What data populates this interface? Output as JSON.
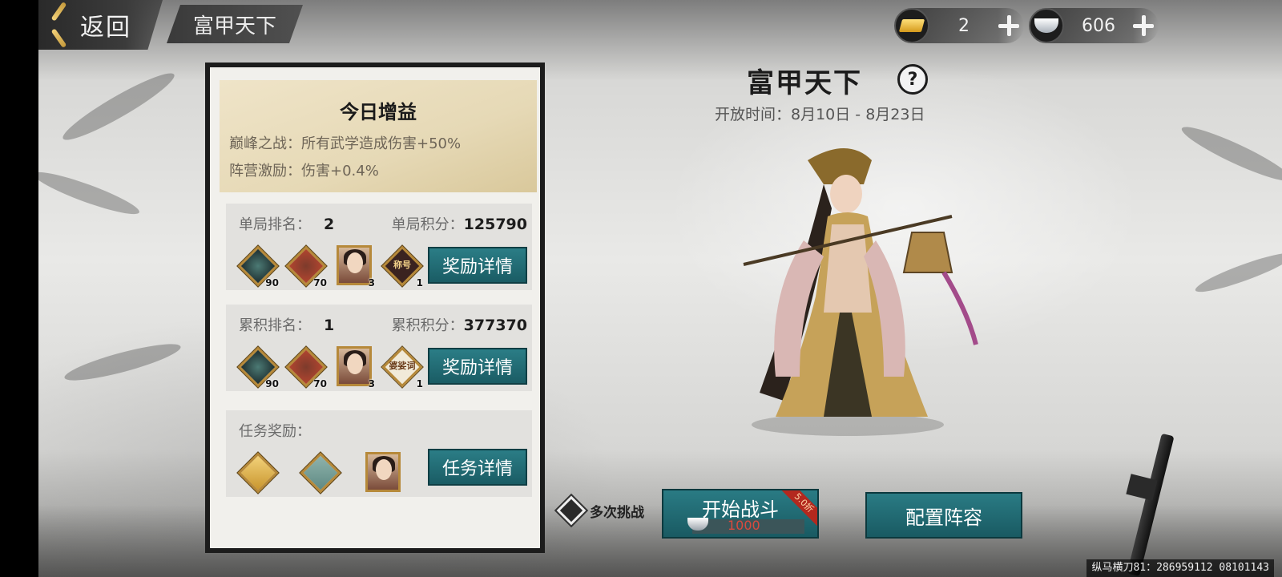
{
  "header": {
    "back_label": "返回",
    "tab_title": "富甲天下"
  },
  "currency": {
    "gold": {
      "icon": "gold-bar-icon",
      "value": "2"
    },
    "silver": {
      "icon": "silver-ingot-icon",
      "value": "606"
    }
  },
  "buff": {
    "title": "今日增益",
    "lines": [
      "巅峰之战：所有武学造成伤害+50%",
      "阵营激励：伤害+0.4%"
    ]
  },
  "single_rank": {
    "rank_label": "单局排名：",
    "rank": "2",
    "score_label": "单局积分：",
    "score": "125790",
    "rewards": [
      {
        "type": "armor",
        "count": "90"
      },
      {
        "type": "pouch",
        "count": "70"
      },
      {
        "type": "portrait",
        "count": "3"
      },
      {
        "type": "title",
        "count": "1",
        "glyph": "称号"
      }
    ],
    "button": "奖励详情"
  },
  "total_rank": {
    "rank_label": "累积排名：",
    "rank": "1",
    "score_label": "累积积分：",
    "score": "377370",
    "rewards": [
      {
        "type": "armor",
        "count": "90"
      },
      {
        "type": "pouch",
        "count": "70"
      },
      {
        "type": "portrait",
        "count": "3"
      },
      {
        "type": "title",
        "count": "1",
        "glyph": "婆娑词"
      }
    ],
    "button": "奖励详情"
  },
  "task": {
    "label": "任务奖励：",
    "button": "任务详情"
  },
  "event": {
    "title": "富甲天下",
    "help": "?",
    "time": "开放时间：8月10日 - 8月23日"
  },
  "actions": {
    "multi_label": "多次挑战",
    "start_label": "开始战斗",
    "start_cost": "1000",
    "discount": "5.0折",
    "formation_label": "配置阵容"
  },
  "watermark": "纵马横刀81：286959112 08101143",
  "colors": {
    "teal_button": "#1f6a72",
    "gold": "#b6893a",
    "cost_red": "#d84a3e"
  }
}
